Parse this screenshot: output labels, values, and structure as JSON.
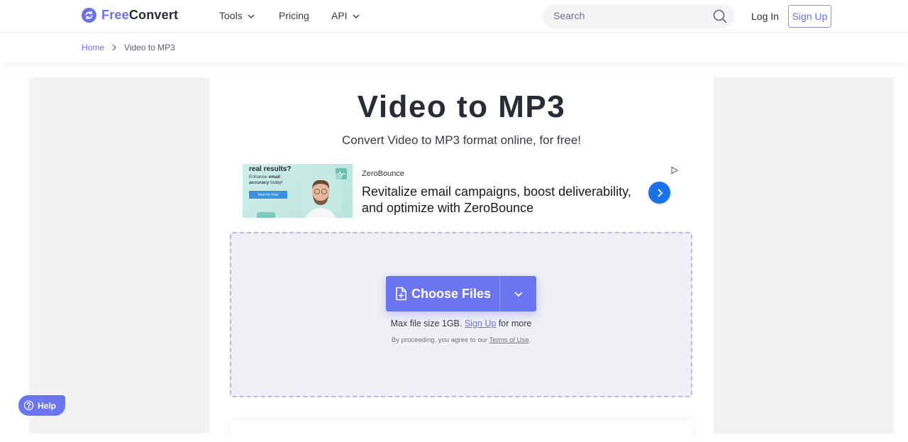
{
  "header": {
    "logo": {
      "part1": "Free",
      "part2": "Convert",
      "icon": "refresh-icon"
    },
    "nav": [
      {
        "label": "Tools",
        "has_dropdown": true
      },
      {
        "label": "Pricing",
        "has_dropdown": false
      },
      {
        "label": "API",
        "has_dropdown": true
      }
    ],
    "search": {
      "placeholder": "Search",
      "value": "",
      "icon": "search-icon"
    },
    "login_label": "Log In",
    "signup_label": "Sign Up"
  },
  "breadcrumb": {
    "items": [
      {
        "label": "Home",
        "link": true
      },
      {
        "label": "Video to MP3",
        "link": false
      }
    ]
  },
  "main": {
    "title": "Video to MP3",
    "subtitle": "Convert Video to MP3 format online, for free!"
  },
  "ad": {
    "image": {
      "headline": "real results?",
      "subline_1": "Enhance ",
      "subline_bold_1": "email",
      "subline_bold_2": "accuracy",
      "subline_2": " today!",
      "button": "Start for Free"
    },
    "brand": "ZeroBounce",
    "text": "Revitalize email campaigns, boost deliverability, and optimize with ZeroBounce",
    "arrow_icon": "chevron-right-icon",
    "choices_icon": "adchoices-icon"
  },
  "upload": {
    "choose_label": "Choose Files",
    "file_icon": "file-add-icon",
    "dropdown_icon": "chevron-down-icon",
    "max_size_prefix": "Max file size 1GB.",
    "max_size_link": "Sign Up",
    "max_size_suffix": "for more",
    "terms_prefix": "By proceeding, you agree to our",
    "terms_link": "Terms of Use",
    "terms_suffix": "."
  },
  "help": {
    "label": "Help",
    "icon": "question-circle-icon"
  },
  "colors": {
    "brand": "#6c71e8",
    "button": "#6c75f0",
    "ad_arrow": "#1a73e8",
    "text": "#272c36"
  }
}
